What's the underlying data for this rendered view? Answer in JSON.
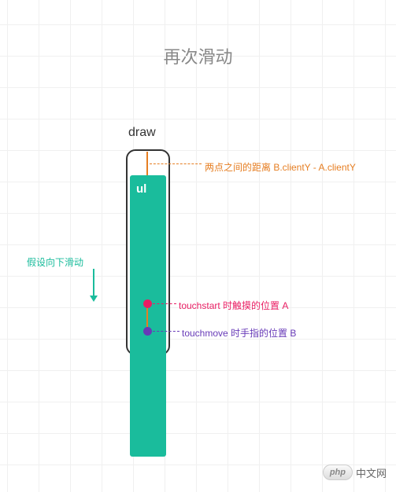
{
  "title": "再次滑动",
  "draw_label": "draw",
  "ul_label": "ul",
  "scroll_hint": "假设向下滑动",
  "distance_label": "两点之间的距离 B.clientY - A.clientY",
  "point_a_label": "touchstart 时触摸的位置 A",
  "point_b_label": "touchmove 时手指的位置 B",
  "watermark": {
    "badge": "php",
    "text": "中文网"
  }
}
